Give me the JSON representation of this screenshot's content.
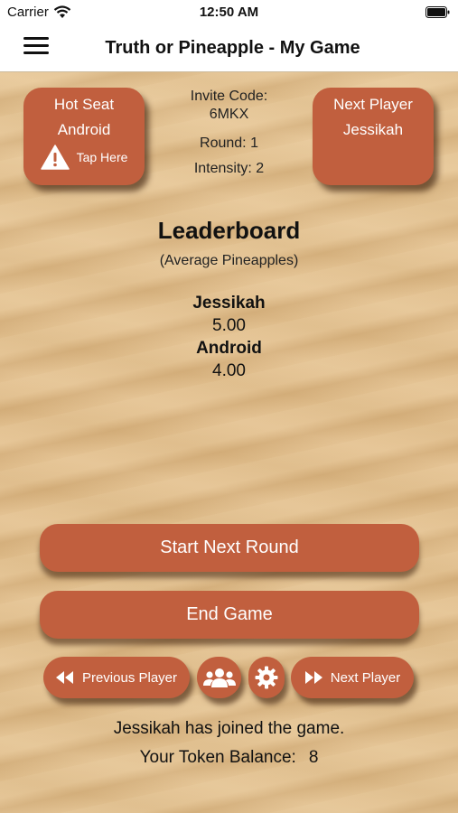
{
  "status": {
    "carrier": "Carrier",
    "time": "12:50 AM"
  },
  "nav": {
    "title": "Truth or Pineapple - My Game",
    "menu_icon": "hamburger-menu-icon"
  },
  "hot_seat": {
    "title": "Hot Seat",
    "player": "Android",
    "action": "Tap Here"
  },
  "next_player_tile": {
    "title": "Next Player",
    "player": "Jessikah"
  },
  "info": {
    "invite_label": "Invite Code:",
    "invite_code": "6MKX",
    "round": "Round: 1",
    "intensity": "Intensity: 2"
  },
  "leaderboard": {
    "title": "Leaderboard",
    "subtitle": "(Average Pineapples)",
    "players": [
      {
        "name": "Jessikah",
        "score": "5.00"
      },
      {
        "name": "Android",
        "score": "4.00"
      }
    ]
  },
  "buttons": {
    "start": "Start Next Round",
    "end": "End Game",
    "previous": "Previous Player",
    "next": "Next Player"
  },
  "message": "Jessikah has joined the game.",
  "token": {
    "label": "Your Token Balance:",
    "value": "8"
  },
  "colors": {
    "accent": "#c15f3e",
    "sand": "#e2c08d",
    "text": "#111111"
  }
}
